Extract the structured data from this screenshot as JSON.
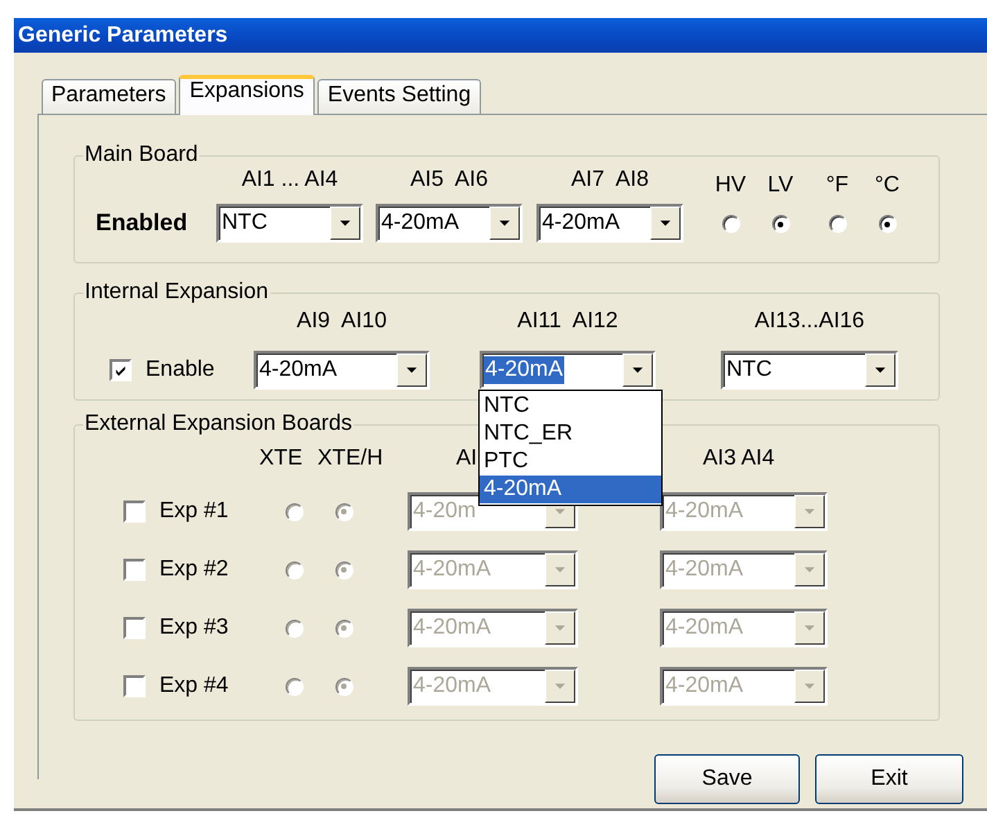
{
  "window": {
    "title": "Generic Parameters"
  },
  "tabs": [
    {
      "label": "Parameters",
      "selected": false
    },
    {
      "label": "Expansions",
      "selected": true
    },
    {
      "label": "Events Setting",
      "selected": false
    }
  ],
  "main_board": {
    "title": "Main Board",
    "label": "Enabled",
    "combos": [
      {
        "header": "AI1 ... AI4",
        "value": "NTC"
      },
      {
        "header": "AI5  AI6",
        "value": "4-20mA"
      },
      {
        "header": "AI7  AI8",
        "value": "4-20mA"
      }
    ],
    "radio_groups": [
      {
        "options": [
          {
            "label": "HV",
            "selected": false
          },
          {
            "label": "LV",
            "selected": true
          }
        ]
      },
      {
        "options": [
          {
            "label": "°F",
            "selected": false
          },
          {
            "label": "°C",
            "selected": true
          }
        ]
      }
    ]
  },
  "internal_expansion": {
    "title": "Internal Expansion",
    "enable": {
      "label": "Enable",
      "checked": true
    },
    "combos": [
      {
        "header": "AI9  AI10",
        "value": "4-20mA",
        "highlighted": false
      },
      {
        "header": "AI11  AI12",
        "value": "4-20mA",
        "highlighted": true,
        "open_list": [
          {
            "label": "NTC",
            "selected": false
          },
          {
            "label": "NTC_ER",
            "selected": false
          },
          {
            "label": "PTC",
            "selected": false
          },
          {
            "label": "4-20mA",
            "selected": true
          }
        ]
      },
      {
        "header": "AI13...AI16",
        "value": "NTC",
        "highlighted": false
      }
    ]
  },
  "external_expansion": {
    "title": "External Expansion Boards",
    "headers": [
      "XTE",
      "XTE/H",
      "AI",
      "AI3 AI4"
    ],
    "rows": [
      {
        "label": "Exp #1",
        "checked": false,
        "types": [
          {
            "selected": false,
            "disabled": true
          },
          {
            "selected": true,
            "disabled": true
          }
        ],
        "combos": [
          {
            "value": "4-20m",
            "disabled": true
          },
          {
            "value": "4-20mA",
            "disabled": true
          }
        ]
      },
      {
        "label": "Exp #2",
        "checked": false,
        "types": [
          {
            "selected": false,
            "disabled": true
          },
          {
            "selected": true,
            "disabled": true
          }
        ],
        "combos": [
          {
            "value": "4-20mA",
            "disabled": true
          },
          {
            "value": "4-20mA",
            "disabled": true
          }
        ]
      },
      {
        "label": "Exp #3",
        "checked": false,
        "types": [
          {
            "selected": false,
            "disabled": true
          },
          {
            "selected": true,
            "disabled": true
          }
        ],
        "combos": [
          {
            "value": "4-20mA",
            "disabled": true
          },
          {
            "value": "4-20mA",
            "disabled": true
          }
        ]
      },
      {
        "label": "Exp #4",
        "checked": false,
        "types": [
          {
            "selected": false,
            "disabled": true
          },
          {
            "selected": true,
            "disabled": true
          }
        ],
        "combos": [
          {
            "value": "4-20mA",
            "disabled": true
          },
          {
            "value": "4-20mA",
            "disabled": true
          }
        ]
      }
    ]
  },
  "buttons": [
    "Save",
    "Exit"
  ]
}
